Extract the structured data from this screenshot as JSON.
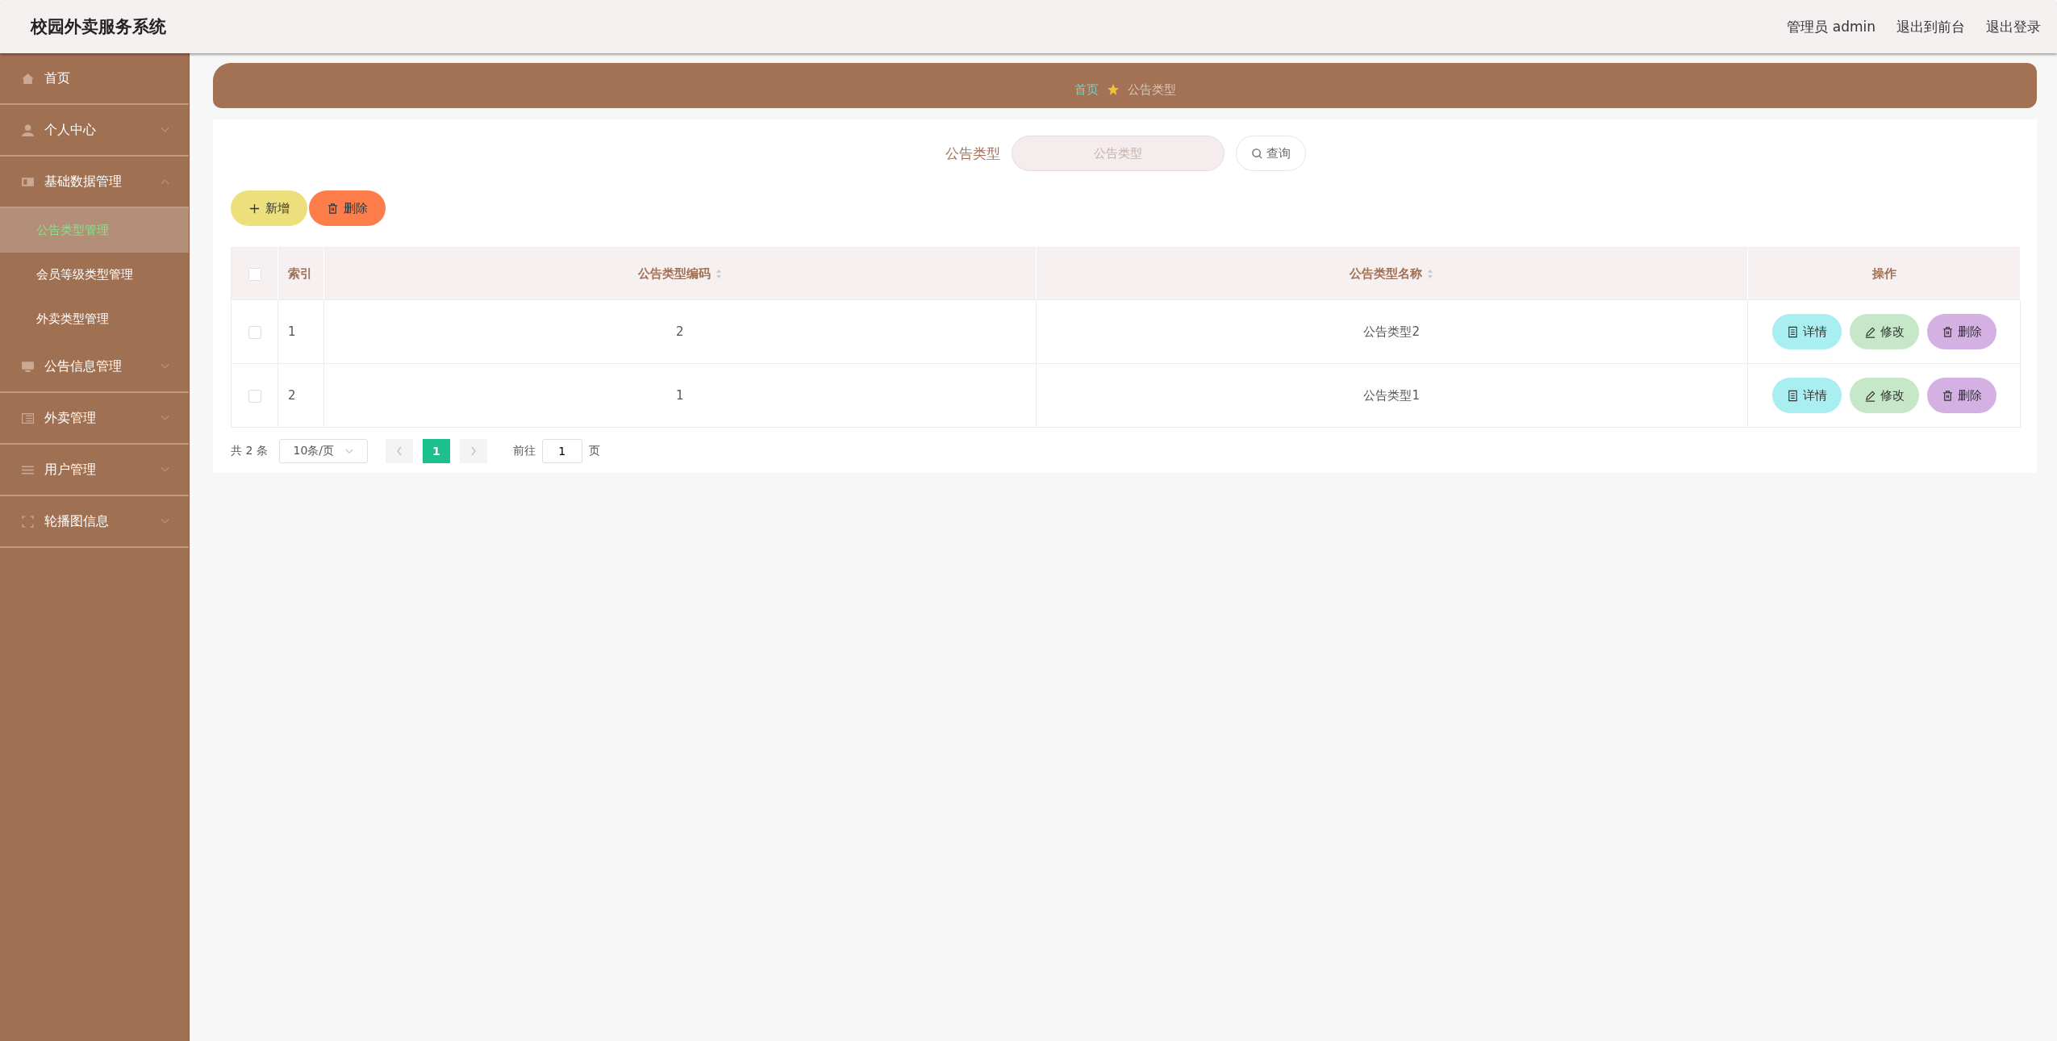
{
  "header": {
    "title": "校园外卖服务系统",
    "user": "管理员 admin",
    "links": [
      "退出到前台",
      "退出登录"
    ]
  },
  "sidebar": {
    "items": [
      {
        "label": "首页",
        "kind": "link"
      },
      {
        "label": "个人中心",
        "kind": "group",
        "expanded": false
      },
      {
        "label": "基础数据管理",
        "kind": "group",
        "expanded": true,
        "children": [
          {
            "label": "公告类型管理",
            "selected": true
          },
          {
            "label": "会员等级类型管理",
            "selected": false
          },
          {
            "label": "外卖类型管理",
            "selected": false
          }
        ]
      },
      {
        "label": "公告信息管理",
        "kind": "group",
        "expanded": false
      },
      {
        "label": "外卖管理",
        "kind": "group",
        "expanded": false
      },
      {
        "label": "用户管理",
        "kind": "group",
        "expanded": false
      },
      {
        "label": "轮播图信息",
        "kind": "group",
        "expanded": false
      }
    ]
  },
  "breadcrumb": [
    "首页",
    "公告类型"
  ],
  "search": {
    "label": "公告类型",
    "placeholder": "公告类型",
    "button": "查询"
  },
  "actions": [
    {
      "label": "新增",
      "kind": "add"
    },
    {
      "label": "删除",
      "kind": "delete"
    }
  ],
  "table": {
    "all_checked": false,
    "columns": [
      {
        "label": "索引",
        "kind": "plain"
      },
      {
        "label": "公告类型编码",
        "kind": "sortable"
      },
      {
        "label": "公告类型名称",
        "kind": "sortable"
      },
      {
        "label": "操作",
        "kind": "plain"
      }
    ],
    "rows": [
      {
        "checked": false,
        "index": "1",
        "code": "2",
        "name": "公告类型2",
        "buttons": [
          {
            "label": "详情",
            "kind": "detail"
          },
          {
            "label": "修改",
            "kind": "edit"
          },
          {
            "label": "删除",
            "kind": "delete"
          }
        ]
      },
      {
        "checked": false,
        "index": "2",
        "code": "1",
        "name": "公告类型1",
        "buttons": [
          {
            "label": "详情",
            "kind": "detail"
          },
          {
            "label": "修改",
            "kind": "edit"
          },
          {
            "label": "删除",
            "kind": "delete"
          }
        ]
      }
    ]
  },
  "pagination": {
    "total": "共 2 条",
    "page_size": "10条/页",
    "pages": [
      {
        "label": "1",
        "selected": true
      }
    ],
    "goto_label": "前往",
    "goto_value": "1",
    "goto_suffix": "页"
  }
}
